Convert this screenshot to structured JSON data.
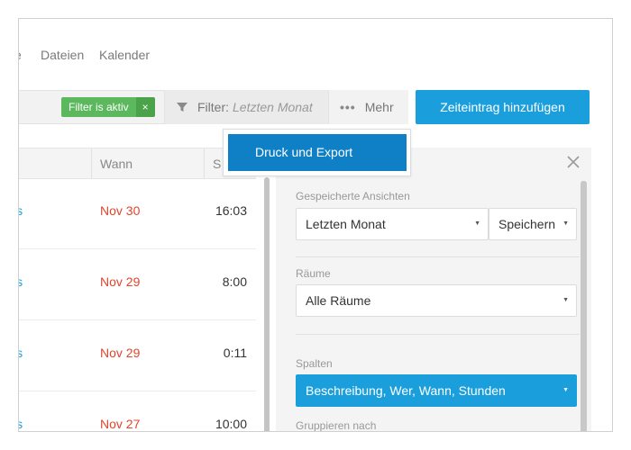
{
  "nav": {
    "partial_item": "e",
    "items": [
      "Dateien",
      "Kalender"
    ]
  },
  "toolbar": {
    "filter_badge": "Filter is aktiv",
    "filter_badge_close": "×",
    "filter_prefix": "Filter:",
    "filter_value": "Letzten Monat",
    "more_dots": "•••",
    "more_label": "Mehr",
    "add_button": "Zeiteintrag hinzufügen"
  },
  "popover": {
    "item": "Druck und Export"
  },
  "table": {
    "columns": [
      "Wann",
      "S"
    ],
    "rows": [
      {
        "desc": "is",
        "date": "Nov 30",
        "time": "16:03"
      },
      {
        "desc": "is",
        "date": "Nov 29",
        "time": "8:00"
      },
      {
        "desc": "is",
        "date": "Nov 29",
        "time": "0:11"
      },
      {
        "desc": "is",
        "date": "Nov 27",
        "time": "10:00"
      }
    ]
  },
  "panel": {
    "close_icon": "close-icon",
    "saved_views_label": "Gespeicherte Ansichten",
    "saved_view_value": "Letzten Monat",
    "save_button": "Speichern",
    "rooms_label": "Räume",
    "rooms_value": "Alle Räume",
    "columns_label": "Spalten",
    "columns_value": "Beschreibung, Wer, Wann, Stunden",
    "group_label": "Gruppieren nach"
  },
  "colors": {
    "accent": "#1a9fdc",
    "accent_dark": "#0f80c6",
    "badge_green": "#5cb85c",
    "date_red": "#e2452c"
  }
}
